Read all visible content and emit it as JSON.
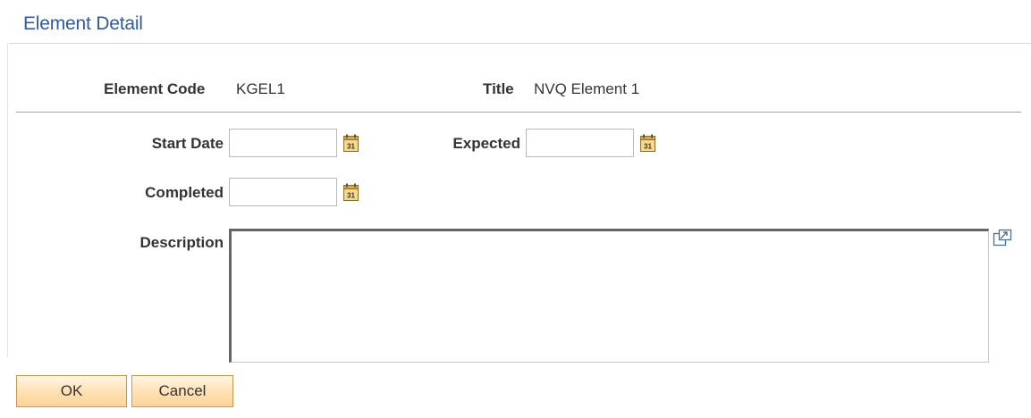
{
  "page": {
    "title": "Element Detail"
  },
  "element": {
    "code_label": "Element Code",
    "code_value": "KGEL1",
    "title_label": "Title",
    "title_value": "NVQ Element 1"
  },
  "form": {
    "start_date": {
      "label": "Start Date",
      "value": ""
    },
    "expected": {
      "label": "Expected",
      "value": ""
    },
    "completed": {
      "label": "Completed",
      "value": ""
    },
    "description": {
      "label": "Description",
      "value": ""
    }
  },
  "icons": {
    "calendar": "calendar-icon",
    "expand": "expand-textarea-icon"
  },
  "buttons": {
    "ok": "OK",
    "cancel": "Cancel"
  },
  "colors": {
    "title": "#33599e",
    "button_fill": "#ffe0b0",
    "button_border": "#c49a52"
  }
}
